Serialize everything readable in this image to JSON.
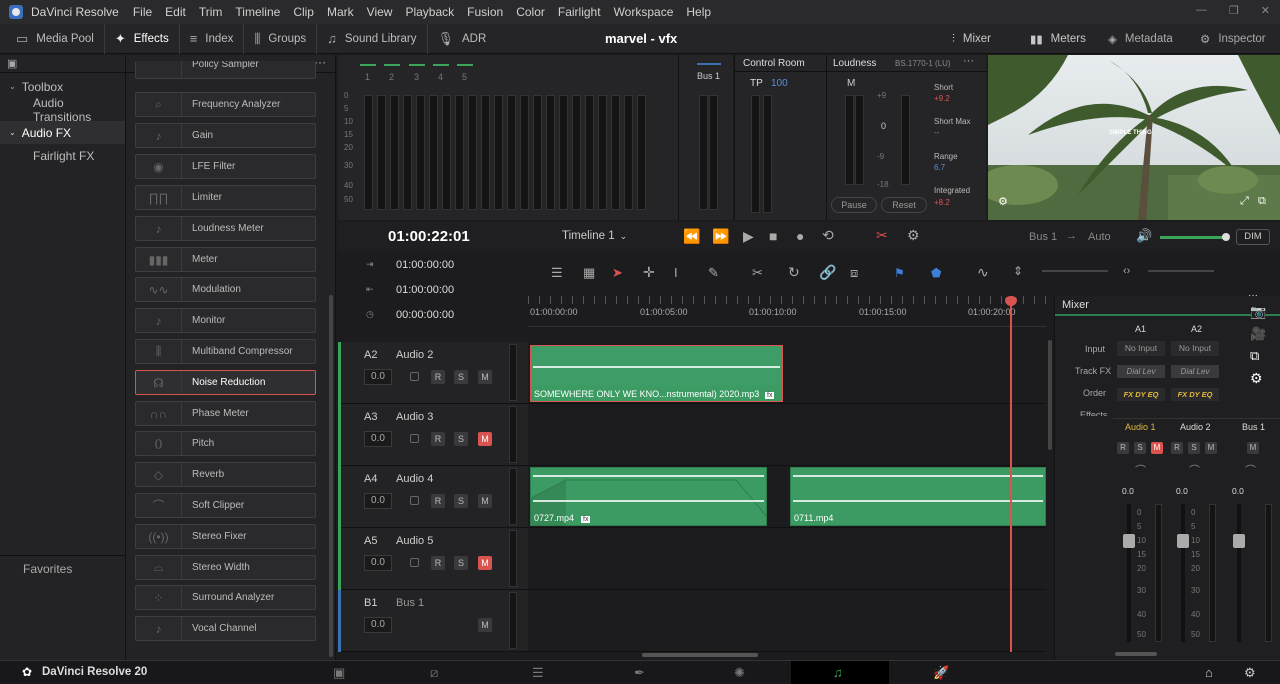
{
  "titlebar": {
    "app_title": "DaVinci Resolve",
    "menus": [
      "File",
      "Edit",
      "Trim",
      "Timeline",
      "Clip",
      "Mark",
      "View",
      "Playback",
      "Fusion",
      "Color",
      "Fairlight",
      "Workspace",
      "Help"
    ]
  },
  "toolbar": {
    "left": [
      {
        "label": "Media Pool"
      },
      {
        "label": "Effects"
      },
      {
        "label": "Index"
      },
      {
        "label": "Groups"
      },
      {
        "label": "Sound Library"
      },
      {
        "label": "ADR"
      }
    ],
    "project": "marvel - vfx",
    "right": [
      {
        "label": "Mixer"
      },
      {
        "label": "Meters"
      },
      {
        "label": "Metadata"
      },
      {
        "label": "Inspector"
      }
    ]
  },
  "sidebar": {
    "items": [
      {
        "label": "Toolbox"
      },
      {
        "label": "Audio Transitions"
      },
      {
        "label": "Audio FX"
      },
      {
        "label": "Fairlight FX"
      }
    ],
    "favorites": "Favorites"
  },
  "effects": [
    "Policy Sampler",
    "Frequency Analyzer",
    "Gain",
    "LFE Filter",
    "Limiter",
    "Loudness Meter",
    "Meter",
    "Modulation",
    "Monitor",
    "Multiband Compressor",
    "Noise Reduction",
    "Phase Meter",
    "Pitch",
    "Reverb",
    "Soft Clipper",
    "Stereo Fixer",
    "Stereo Width",
    "Surround Analyzer",
    "Vocal Channel"
  ],
  "meters": {
    "channels": [
      "1",
      "2",
      "3",
      "4",
      "5"
    ],
    "scale": [
      "0",
      "5",
      "10",
      "15",
      "20",
      "30",
      "40",
      "50"
    ],
    "bus": "Bus 1"
  },
  "control_room": {
    "title": "Control Room",
    "tp_label": "TP",
    "tp_value": "100"
  },
  "loudness": {
    "title": "Loudness",
    "standard": "BS.1770-1 (LU)",
    "m_label": "M",
    "scale": [
      "+9",
      "0",
      "-9",
      "-18"
    ],
    "zero": "0",
    "stats": [
      {
        "label": "Short",
        "value": "+9.2"
      },
      {
        "label": "Short Max",
        "value": "--"
      },
      {
        "label": "Range",
        "value": "6.7"
      },
      {
        "label": "Integrated",
        "value": "+8.2"
      }
    ],
    "pause": "Pause",
    "reset": "Reset"
  },
  "viewer": {
    "overlay_text": "SIMPLE THING"
  },
  "transport": {
    "timecode": "01:00:22:01",
    "timeline_name": "Timeline 1",
    "bus_label": "Bus 1",
    "arrow": "→",
    "auto": "Auto",
    "dim": "DIM"
  },
  "timecodes": [
    "01:00:00:00",
    "01:00:00:00",
    "00:00:00:00"
  ],
  "ruler": [
    "01:00:00:00",
    "01:00:05:00",
    "01:00:10:00",
    "01:00:15:00",
    "01:00:20:00"
  ],
  "tracks": [
    {
      "id": "A2",
      "name": "Audio 2",
      "vol": "0.0"
    },
    {
      "id": "A3",
      "name": "Audio 3",
      "vol": "0.0"
    },
    {
      "id": "A4",
      "name": "Audio 4",
      "vol": "0.0"
    },
    {
      "id": "A5",
      "name": "Audio 5",
      "vol": "0.0"
    },
    {
      "id": "B1",
      "name": "Bus 1",
      "vol": "0.0"
    }
  ],
  "rsm": {
    "r": "R",
    "s": "S",
    "m": "M"
  },
  "clips": {
    "a2": "SOMEWHERE ONLY WE KNO...nstrumental) 2020.mp3",
    "a4_1": "0727.mp4",
    "a4_2": "0711.mp4",
    "fx": "fx"
  },
  "mixer": {
    "title": "Mixer",
    "cols": [
      "A1",
      "A2"
    ],
    "row_labels": [
      "Input",
      "Track FX",
      "Order",
      "Effects"
    ],
    "input": "No Input",
    "dial": "Dial Lev",
    "order": "FX DY EQ",
    "channels": [
      "Audio 1",
      "Audio 2",
      "Bus 1"
    ],
    "vol": "0.0",
    "scale": [
      "0",
      "5",
      "10",
      "15",
      "20",
      "30",
      "40",
      "50"
    ]
  },
  "bottom": {
    "brand": "DaVinci Resolve 20"
  }
}
